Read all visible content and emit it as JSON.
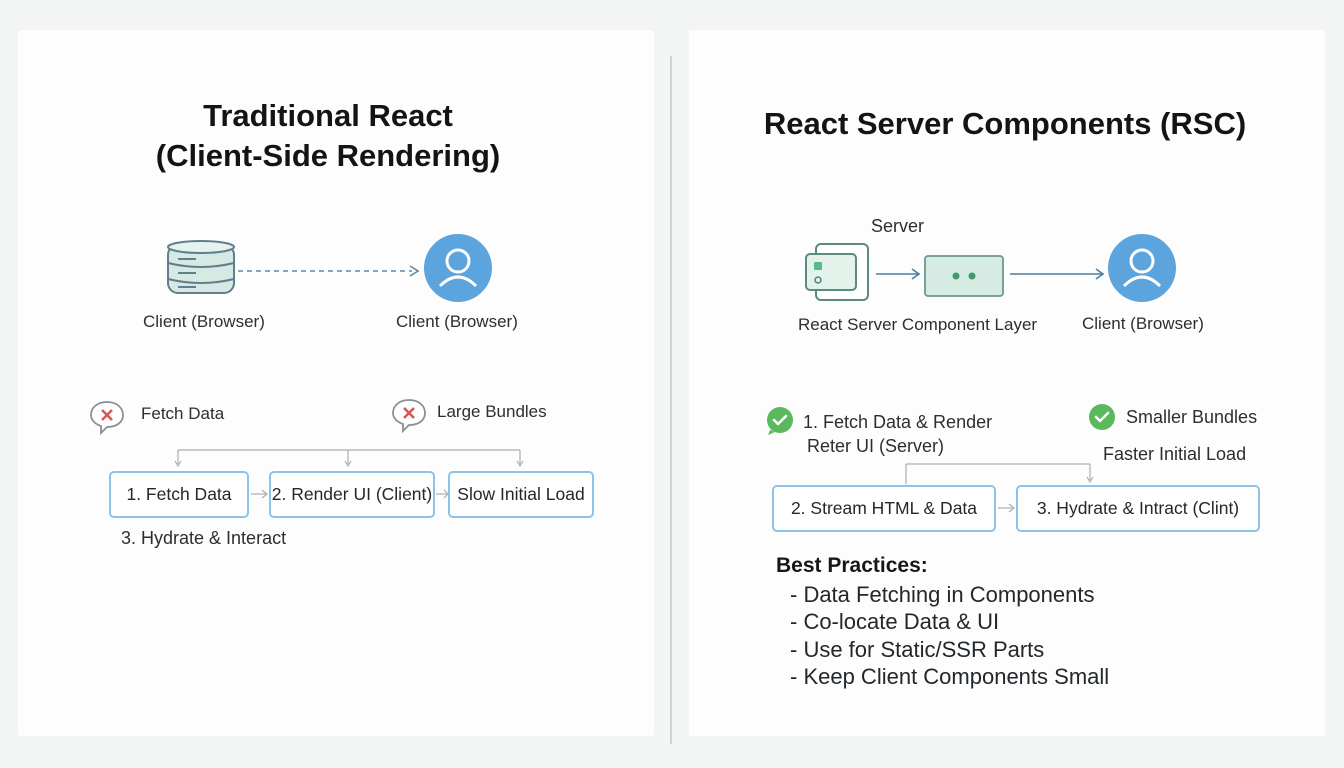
{
  "left": {
    "title_line1": "Traditional React",
    "title_line2": "(Client-Side Rendering)",
    "node_server_label": "Client (Browser)",
    "node_client_label": "Client (Browser)",
    "issue_fetch": "Fetch Data",
    "issue_bundles": "Large Bundles",
    "steps": [
      "1. Fetch Data",
      "2. Render UI (Client)",
      "Slow Initial Load"
    ],
    "step_below": "3. Hydrate & Interact"
  },
  "right": {
    "title": "React Server Components (RSC)",
    "server_label": "Server",
    "layer_label": "React Server Component Layer",
    "client_label": "Client (Browser)",
    "benefit_fetch_line1": "1. Fetch Data & Render",
    "benefit_fetch_line2": "Reter UI (Server)",
    "benefit_bundles": "Smaller Bundles",
    "benefit_load": "Faster Initial Load",
    "steps": [
      "2. Stream HTML & Data",
      "3. Hydrate & Intract (Clint)"
    ],
    "best_practices": {
      "title": "Best Practices:",
      "items": [
        "- Data Fetching in Components",
        "- Co-locate Data & UI",
        "- Use for Static/SSR Parts",
        "- Keep Client Components Small"
      ]
    }
  },
  "colors": {
    "accent_blue": "#5ba4dd",
    "success_green": "#5cb85c",
    "error_red": "#d9534f",
    "teal_box": "#d6ebe3"
  },
  "icons": [
    "database-icon",
    "user-avatar-icon",
    "error-x-icon",
    "check-icon",
    "server-component-icon",
    "layer-box-icon"
  ]
}
